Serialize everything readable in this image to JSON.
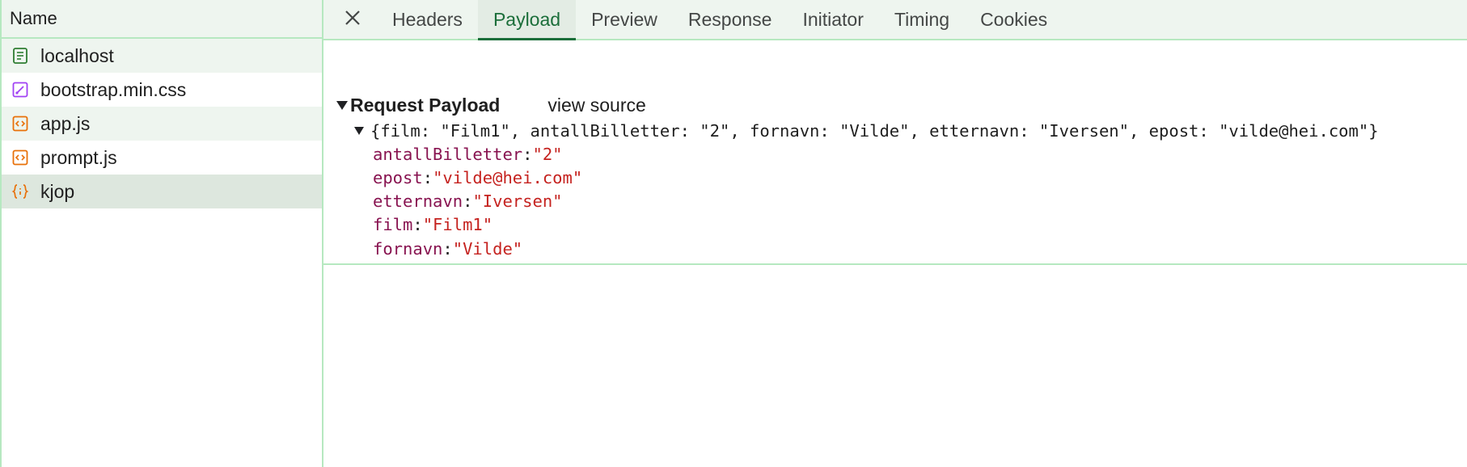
{
  "left_panel": {
    "header": "Name",
    "requests": [
      {
        "name": "localhost",
        "icon": "document-icon",
        "color": "#2e7d32"
      },
      {
        "name": "bootstrap.min.css",
        "icon": "stylesheet-icon",
        "color": "#a142f4"
      },
      {
        "name": "app.js",
        "icon": "script-icon",
        "color": "#e8710a"
      },
      {
        "name": "prompt.js",
        "icon": "script-icon",
        "color": "#e8710a"
      },
      {
        "name": "kjop",
        "icon": "fetch-json-icon",
        "color": "#e8710a",
        "selected": true
      }
    ]
  },
  "tabs": [
    {
      "label": "Headers"
    },
    {
      "label": "Payload",
      "active": true
    },
    {
      "label": "Preview"
    },
    {
      "label": "Response"
    },
    {
      "label": "Initiator"
    },
    {
      "label": "Timing"
    },
    {
      "label": "Cookies"
    }
  ],
  "payload": {
    "section_title": "Request Payload",
    "view_source_label": "view source",
    "summary": "{film: \"Film1\", antallBilletter: \"2\", fornavn: \"Vilde\", etternavn: \"Iversen\", epost: \"vilde@hei.com\"}",
    "properties": [
      {
        "key": "antallBilletter",
        "value": "\"2\""
      },
      {
        "key": "epost",
        "value": "\"vilde@hei.com\""
      },
      {
        "key": "etternavn",
        "value": "\"Iversen\""
      },
      {
        "key": "film",
        "value": "\"Film1\""
      },
      {
        "key": "fornavn",
        "value": "\"Vilde\""
      }
    ]
  },
  "colors": {
    "accent": "#1b6e3a",
    "border": "#b6e8c0",
    "key": "#881350",
    "string": "#c5221f"
  }
}
